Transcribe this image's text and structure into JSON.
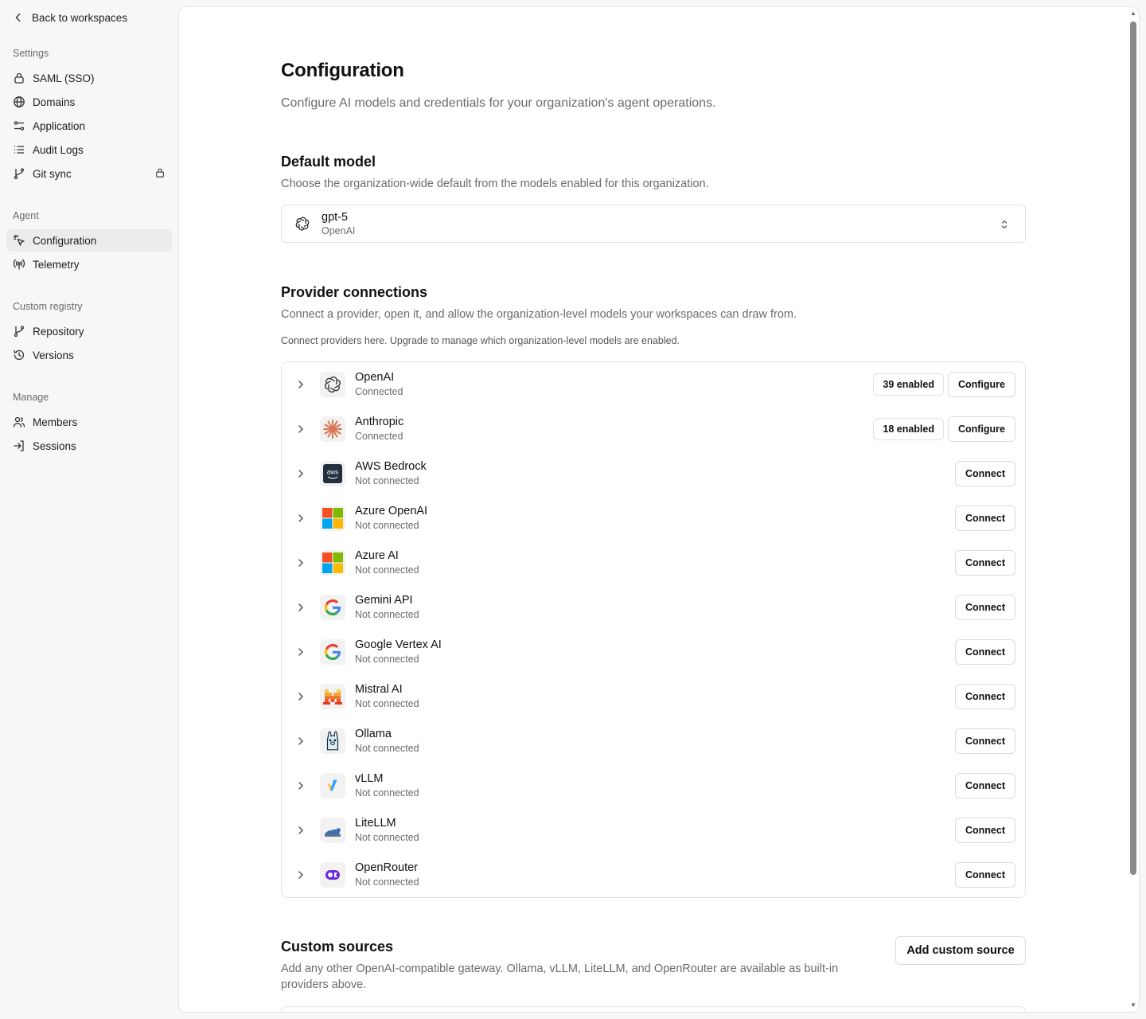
{
  "sidebar": {
    "back_label": "Back to workspaces",
    "sections": [
      {
        "label": "Settings",
        "items": [
          {
            "label": "SAML (SSO)",
            "icon": "lock-icon"
          },
          {
            "label": "Domains",
            "icon": "globe-icon"
          },
          {
            "label": "Application",
            "icon": "sliders-icon"
          },
          {
            "label": "Audit Logs",
            "icon": "list-icon"
          },
          {
            "label": "Git sync",
            "icon": "git-branch-icon",
            "locked": true
          }
        ]
      },
      {
        "label": "Agent",
        "items": [
          {
            "label": "Configuration",
            "icon": "sparkle-cursor-icon",
            "active": true
          },
          {
            "label": "Telemetry",
            "icon": "radio-tower-icon"
          }
        ]
      },
      {
        "label": "Custom registry",
        "items": [
          {
            "label": "Repository",
            "icon": "git-branch-icon"
          },
          {
            "label": "Versions",
            "icon": "history-icon"
          }
        ]
      },
      {
        "label": "Manage",
        "items": [
          {
            "label": "Members",
            "icon": "users-icon"
          },
          {
            "label": "Sessions",
            "icon": "sign-in-icon"
          }
        ]
      }
    ]
  },
  "page": {
    "title": "Configuration",
    "subtitle": "Configure AI models and credentials for your organization's agent operations."
  },
  "default_model": {
    "heading": "Default model",
    "description": "Choose the organization-wide default from the models enabled for this organization.",
    "selected_model": "gpt-5",
    "selected_provider": "OpenAI"
  },
  "providers": {
    "heading": "Provider connections",
    "description": "Connect a provider, open it, and allow the organization-level models your workspaces can draw from.",
    "note": "Connect providers here. Upgrade to manage which organization-level models are enabled.",
    "items": [
      {
        "name": "OpenAI",
        "status": "Connected",
        "badge": "39 enabled",
        "action": "Configure",
        "icon": "openai-logo-icon"
      },
      {
        "name": "Anthropic",
        "status": "Connected",
        "badge": "18 enabled",
        "action": "Configure",
        "icon": "anthropic-logo-icon"
      },
      {
        "name": "AWS Bedrock",
        "status": "Not connected",
        "action": "Connect",
        "icon": "aws-logo-icon"
      },
      {
        "name": "Azure OpenAI",
        "status": "Not connected",
        "action": "Connect",
        "icon": "microsoft-logo-icon"
      },
      {
        "name": "Azure AI",
        "status": "Not connected",
        "action": "Connect",
        "icon": "microsoft-logo-icon"
      },
      {
        "name": "Gemini API",
        "status": "Not connected",
        "action": "Connect",
        "icon": "google-logo-icon"
      },
      {
        "name": "Google Vertex AI",
        "status": "Not connected",
        "action": "Connect",
        "icon": "google-logo-icon"
      },
      {
        "name": "Mistral AI",
        "status": "Not connected",
        "action": "Connect",
        "icon": "mistral-logo-icon"
      },
      {
        "name": "Ollama",
        "status": "Not connected",
        "action": "Connect",
        "icon": "ollama-logo-icon"
      },
      {
        "name": "vLLM",
        "status": "Not connected",
        "action": "Connect",
        "icon": "vllm-logo-icon"
      },
      {
        "name": "LiteLLM",
        "status": "Not connected",
        "action": "Connect",
        "icon": "litellm-logo-icon"
      },
      {
        "name": "OpenRouter",
        "status": "Not connected",
        "action": "Connect",
        "icon": "openrouter-logo-icon"
      }
    ]
  },
  "custom_sources": {
    "heading": "Custom sources",
    "description": "Add any other OpenAI-compatible gateway. Ollama, vLLM, LiteLLM, and OpenRouter are available as built-in providers above.",
    "add_button": "Add custom source"
  }
}
